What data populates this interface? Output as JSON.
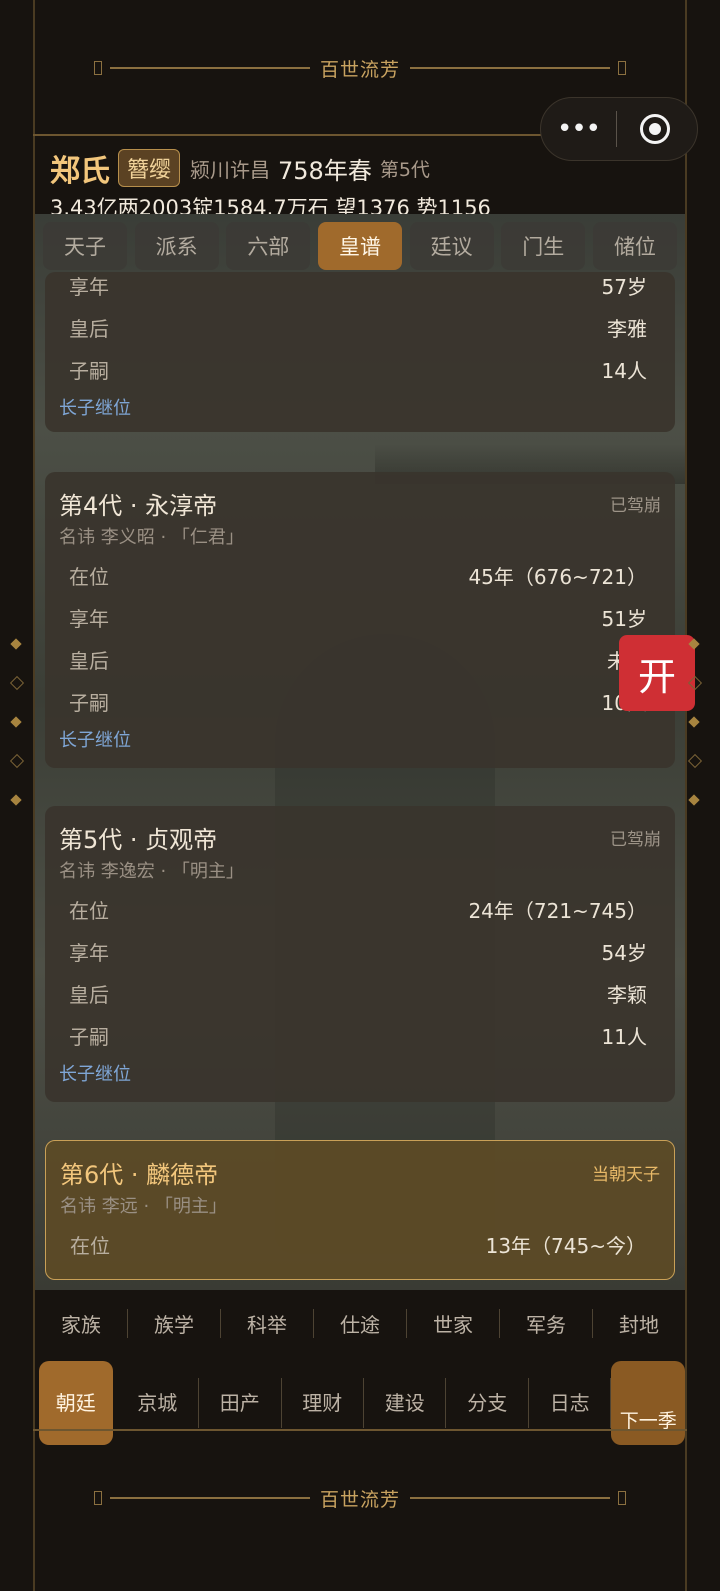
{
  "banner_top": {
    "text": "百世流芳"
  },
  "banner_bottom": {
    "text": "百世流芳"
  },
  "capsule": {
    "more_icon": "more-dots-icon",
    "close_icon": "target-icon"
  },
  "header": {
    "family_name": "郑氏",
    "rank_badge": "簪缨",
    "origin": "颍川许昌",
    "year_season": "758年春",
    "generation": "第5代",
    "stats": "3.43亿两2003锭1584.7万石  望1376 势1156"
  },
  "tabs": [
    "天子",
    "派系",
    "六部",
    "皇谱",
    "廷议",
    "门生",
    "储位"
  ],
  "active_tab": "皇谱",
  "cards": [
    {
      "title": "",
      "status": "",
      "subtitle": "",
      "rows": [
        {
          "label": "享年",
          "value": "57岁"
        },
        {
          "label": "皇后",
          "value": "李雅"
        },
        {
          "label": "子嗣",
          "value": "14人"
        }
      ],
      "succession": "长子继位"
    },
    {
      "title": "第4代 · 永淳帝",
      "status": "已驾崩",
      "subtitle": "名讳 李义昭 · 「仁君」",
      "rows": [
        {
          "label": "在位",
          "value": "45年（676~721）"
        },
        {
          "label": "享年",
          "value": "51岁"
        },
        {
          "label": "皇后",
          "value": "未立"
        },
        {
          "label": "子嗣",
          "value": "10人"
        }
      ],
      "succession": "长子继位"
    },
    {
      "title": "第5代 · 贞观帝",
      "status": "已驾崩",
      "subtitle": "名讳 李逸宏 · 「明主」",
      "rows": [
        {
          "label": "在位",
          "value": "24年（721~745）"
        },
        {
          "label": "享年",
          "value": "54岁"
        },
        {
          "label": "皇后",
          "value": "李颖"
        },
        {
          "label": "子嗣",
          "value": "11人"
        }
      ],
      "succession": "长子继位"
    },
    {
      "title": "第6代 · 麟德帝",
      "status": "当朝天子",
      "subtitle": "名讳 李远 · 「明主」",
      "rows": [
        {
          "label": "在位",
          "value": "13年（745~今）"
        }
      ]
    }
  ],
  "float_button": {
    "label": "开"
  },
  "bottom_nav_row1": [
    "家族",
    "族学",
    "科举",
    "仕途",
    "世家",
    "军务",
    "封地"
  ],
  "bottom_nav_row2": [
    "朝廷",
    "京城",
    "田产",
    "理财",
    "建设",
    "分支",
    "日志"
  ],
  "bottom_nav_active": "朝廷",
  "next_season_label": "下一季"
}
